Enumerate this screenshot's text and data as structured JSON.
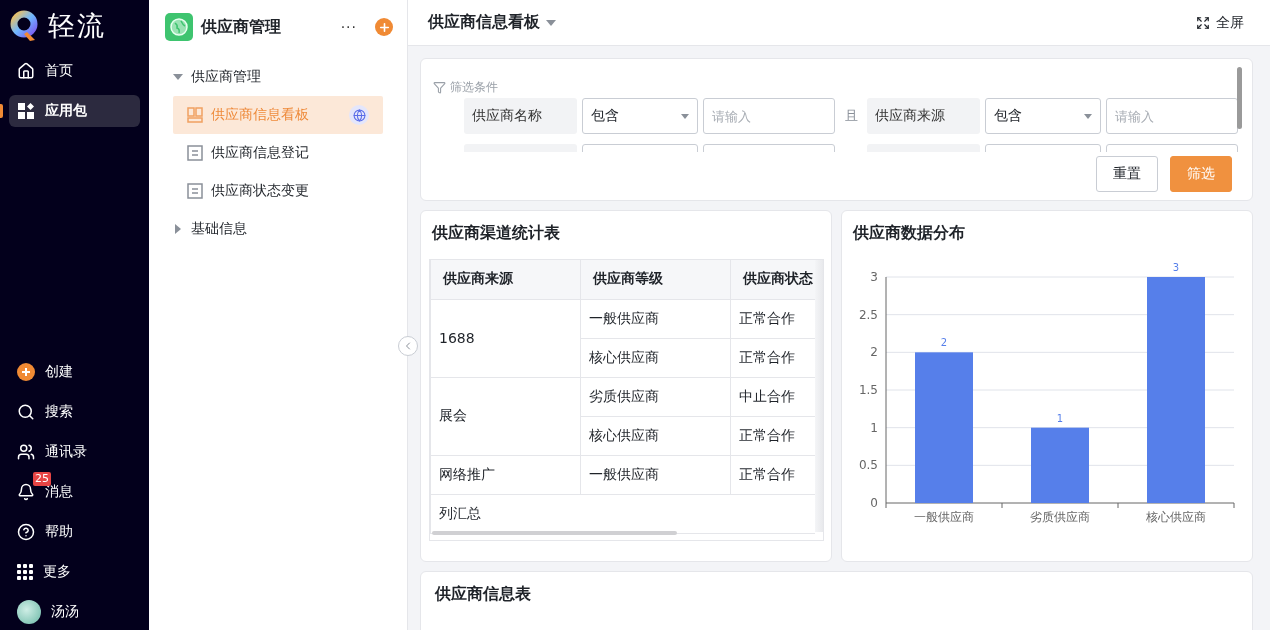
{
  "nav": {
    "brand": "轻流",
    "top_items": [
      {
        "label": "首页",
        "kind": "home",
        "selected": false
      },
      {
        "label": "应用包",
        "kind": "apps",
        "selected": true
      }
    ],
    "bottom_items": [
      {
        "label": "创建",
        "kind": "create"
      },
      {
        "label": "搜索",
        "kind": "search"
      },
      {
        "label": "通讯录",
        "kind": "contacts"
      },
      {
        "label": "消息",
        "kind": "bell",
        "badge": "25"
      },
      {
        "label": "帮助",
        "kind": "help"
      },
      {
        "label": "更多",
        "kind": "more"
      },
      {
        "label": "汤汤",
        "kind": "avatar"
      }
    ]
  },
  "app_sidebar": {
    "title": "供应商管理",
    "more": "···",
    "tree": [
      {
        "label": "供应商管理",
        "expanded": true,
        "children": [
          {
            "label": "供应商信息看板",
            "kind": "dashboard",
            "selected": true,
            "published": true
          },
          {
            "label": "供应商信息登记",
            "kind": "form",
            "selected": false,
            "published": false
          },
          {
            "label": "供应商状态变更",
            "kind": "form",
            "selected": false,
            "published": false
          }
        ]
      },
      {
        "label": "基础信息",
        "expanded": false
      }
    ]
  },
  "header": {
    "title": "供应商信息看板",
    "fullscreen": "全屏"
  },
  "filter": {
    "title": "筛选条件",
    "joiner": "且",
    "conditions": [
      {
        "field": "供应商名称",
        "operator": "包含",
        "placeholder": "请输入"
      },
      {
        "field": "供应商来源",
        "operator": "包含",
        "placeholder": "请输入"
      }
    ],
    "more_rows_cut": true,
    "buttons": [
      {
        "label": "重置",
        "kind": "secondary"
      },
      {
        "label": "筛选",
        "kind": "primary"
      }
    ]
  },
  "channel_table": {
    "title": "供应商渠道统计表",
    "columns": [
      "供应商来源",
      "供应商等级",
      "供应商状态"
    ],
    "groups": [
      {
        "source": "1688",
        "rows": [
          [
            "一般供应商",
            "正常合作"
          ],
          [
            "核心供应商",
            "正常合作"
          ]
        ]
      },
      {
        "source": "展会",
        "rows": [
          [
            "劣质供应商",
            "中止合作"
          ],
          [
            "核心供应商",
            "正常合作"
          ]
        ]
      },
      {
        "source": "网络推广",
        "rows": [
          [
            "一般供应商",
            "正常合作"
          ]
        ]
      }
    ],
    "summary": "列汇总"
  },
  "distribution": {
    "title": "供应商数据分布",
    "chart_data": {
      "type": "bar",
      "categories": [
        "一般供应商",
        "劣质供应商",
        "核心供应商"
      ],
      "series": [
        {
          "color": "#567fea",
          "values": [
            2,
            1,
            3
          ]
        }
      ],
      "ylim": [
        0,
        3
      ],
      "yticks": [
        0,
        0.5,
        1,
        1.5,
        2,
        2.5,
        3
      ],
      "data_labels": true,
      "grid": true
    }
  },
  "info_table": {
    "title": "供应商信息表"
  }
}
